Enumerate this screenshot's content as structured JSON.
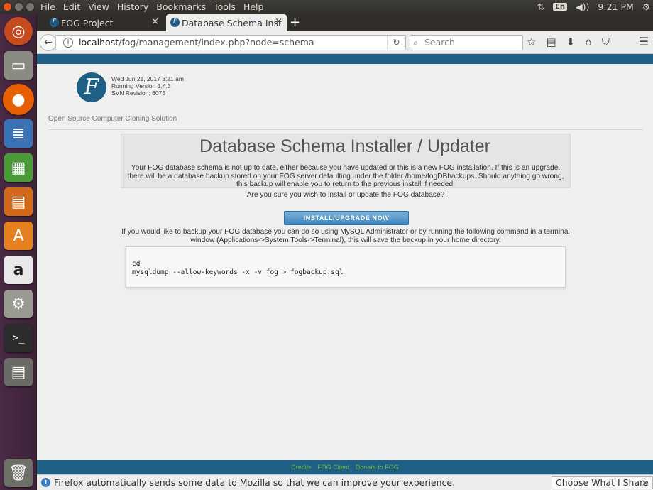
{
  "desktop": {
    "menu": [
      "File",
      "Edit",
      "View",
      "History",
      "Bookmarks",
      "Tools",
      "Help"
    ],
    "keyboard_layout": "En",
    "clock": "9:21 PM"
  },
  "launcher": [
    {
      "name": "ubuntu-dash-icon",
      "color": "#c54b1f"
    },
    {
      "name": "files-icon",
      "color": "#8a8a84"
    },
    {
      "name": "firefox-icon",
      "color": "#e66000"
    },
    {
      "name": "writer-icon",
      "color": "#3a72b5"
    },
    {
      "name": "calc-icon",
      "color": "#4a9a3a"
    },
    {
      "name": "impress-icon",
      "color": "#d0691a"
    },
    {
      "name": "software-center-icon",
      "color": "#e4801f"
    },
    {
      "name": "amazon-icon",
      "color": "#e8e8e8"
    },
    {
      "name": "system-settings-icon",
      "color": "#9a9a94"
    },
    {
      "name": "terminal-icon",
      "color": "#2c2c2c"
    },
    {
      "name": "disk-icon",
      "color": "#6a6a66"
    },
    {
      "name": "trash-icon",
      "color": "#6f6f6a"
    }
  ],
  "browser": {
    "tabs": [
      {
        "label": "FOG Project"
      },
      {
        "label": "Database Schema Inst"
      }
    ],
    "url_host": "localhost",
    "url_path": "/fog/management/index.php?node=schema",
    "search_placeholder": "Search"
  },
  "page": {
    "logo_letter": "F",
    "date": "Wed Jun 21, 2017 3:21 am",
    "version": "Running Version 1.4.3",
    "svn": "SVN Revision: 6075",
    "tagline": "Open Source Computer Cloning Solution",
    "title": "Database Schema Installer / Updater",
    "intro": "Your FOG database schema is not up to date, either because you have updated or this is a new FOG installation. If this is an upgrade, there will be a database backup stored on your FOG server defaulting under the folder /home/fogDBbackups. Should anything go wrong, this backup will enable you to return to the previous install if needed.",
    "confirm": "Are you sure you wish to install or update the FOG database?",
    "install_button": "Install/Upgrade Now",
    "backup_note": "If you would like to backup your FOG database you can do so using MySQL Administrator or by running the following command in a terminal window (Applications->System Tools->Terminal), this will save the backup in your home directory.",
    "code_line1": "cd",
    "code_line2": "mysqldump --allow-keywords -x -v fog > fogbackup.sql",
    "footer": [
      "Credits",
      "FOG Client",
      "Donate to FOG"
    ]
  },
  "notification": {
    "message": "Firefox automatically sends some data to Mozilla so that we can improve your experience.",
    "button": "Choose What I Share"
  },
  "colors": {
    "fog_blue": "#1f5f85",
    "footer_link": "#6cb33e",
    "ubuntu_orange": "#e95420"
  }
}
